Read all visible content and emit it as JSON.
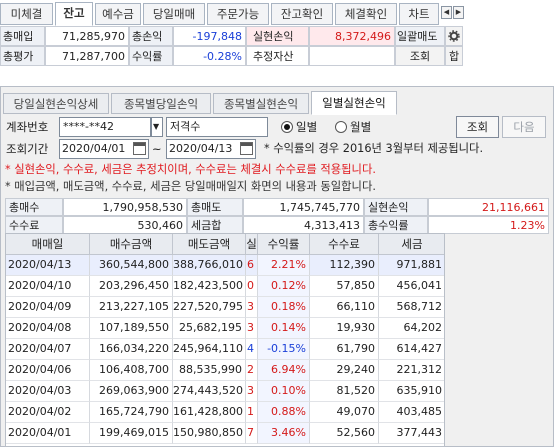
{
  "top_tabs": [
    "미체결",
    "잔고",
    "예수금",
    "당일매매",
    "주문가능",
    "잔고확인",
    "체결확인",
    "차트"
  ],
  "top_tabs_active_index": 1,
  "nav_buttons": {
    "prev": "◀",
    "next": "▶"
  },
  "summary": {
    "row1": {
      "total_buy_label": "총매입",
      "total_buy_value": "71,285,970",
      "total_pl_label": "총손익",
      "total_pl_value": "-197,848",
      "realized_label": "실현손익",
      "realized_value": "8,372,496",
      "batch_sell_label": "일괄매도"
    },
    "row2": {
      "total_eval_label": "총평가",
      "total_eval_value": "71,287,700",
      "return_label": "수익률",
      "return_value": "-0.28%",
      "estimated_label": "추정자산",
      "query_label": "조회",
      "sum_label": "합"
    }
  },
  "sub_tabs": [
    "당일실현손익상세",
    "종목별당일손익",
    "종목별실현손익",
    "일별실현손익"
  ],
  "sub_tabs_active_index": 3,
  "form": {
    "account_label": "계좌번호",
    "account_value": "****-**42",
    "account_name": "저격수",
    "radio_daily": "일별",
    "radio_monthly": "월별",
    "radio_selected": "daily",
    "query_button": "조회",
    "next_button": "다음",
    "period_label": "조회기간",
    "date_from": "2020/04/01",
    "tilde": "~",
    "date_to": "2020/04/13",
    "period_note": "* 수익률의 경우 2016년 3월부터 제공됩니다."
  },
  "notes": {
    "line1": "* 실현손익, 수수료, 세금은 추정치이며, 수수료는 체결시 수수료를 적용됩니다.",
    "line2": "* 매입금액, 매도금액, 수수료, 세금은 당일매매일지 화면의 내용과 동일합니다."
  },
  "totals": {
    "total_buy_label": "총매수",
    "total_buy_value": "1,790,958,530",
    "total_sell_label": "총매도",
    "total_sell_value": "1,745,745,770",
    "realized_label": "실현손익",
    "realized_value": "21,116,661",
    "fee_label": "수수료",
    "fee_value": "530,460",
    "tax_label": "세금합",
    "tax_value": "4,313,413",
    "return_label": "총수익률",
    "return_value": "1.23%"
  },
  "grid": {
    "columns": [
      "매매일",
      "매수금액",
      "매도금액",
      "실",
      "수익률",
      "수수료",
      "세금"
    ],
    "rows": [
      {
        "date": "2020/04/13",
        "buy": "360,544,800",
        "sell": "388,766,010",
        "pl": "6",
        "ret": "2.21%",
        "fee": "112,390",
        "tax": "971,881",
        "sign": "pos",
        "selected": true
      },
      {
        "date": "2020/04/10",
        "buy": "203,296,450",
        "sell": "182,423,500",
        "pl": "0",
        "ret": "0.12%",
        "fee": "57,850",
        "tax": "456,041",
        "sign": "pos",
        "selected": false
      },
      {
        "date": "2020/04/09",
        "buy": "213,227,105",
        "sell": "227,520,795",
        "pl": "3",
        "ret": "0.18%",
        "fee": "66,110",
        "tax": "568,712",
        "sign": "pos",
        "selected": false
      },
      {
        "date": "2020/04/08",
        "buy": "107,189,550",
        "sell": "25,682,195",
        "pl": "3",
        "ret": "0.14%",
        "fee": "19,930",
        "tax": "64,202",
        "sign": "pos",
        "selected": false
      },
      {
        "date": "2020/04/07",
        "buy": "166,034,220",
        "sell": "245,964,110",
        "pl": "4",
        "ret": "-0.15%",
        "fee": "61,790",
        "tax": "614,427",
        "sign": "neg",
        "selected": false
      },
      {
        "date": "2020/04/06",
        "buy": "106,408,700",
        "sell": "88,535,990",
        "pl": "2",
        "ret": "6.94%",
        "fee": "29,240",
        "tax": "221,312",
        "sign": "pos",
        "selected": false
      },
      {
        "date": "2020/04/03",
        "buy": "269,063,900",
        "sell": "274,443,520",
        "pl": "3",
        "ret": "0.10%",
        "fee": "81,520",
        "tax": "635,910",
        "sign": "pos",
        "selected": false
      },
      {
        "date": "2020/04/02",
        "buy": "165,724,790",
        "sell": "161,428,800",
        "pl": "1",
        "ret": "0.88%",
        "fee": "49,070",
        "tax": "403,485",
        "sign": "pos",
        "selected": false
      },
      {
        "date": "2020/04/01",
        "buy": "199,469,015",
        "sell": "150,980,850",
        "pl": "7",
        "ret": "3.46%",
        "fee": "52,560",
        "tax": "377,443",
        "sign": "pos",
        "selected": false
      }
    ]
  },
  "colors": {
    "positive": "#d41919",
    "negative": "#1a3fd8",
    "note_red": "#e0191e"
  }
}
